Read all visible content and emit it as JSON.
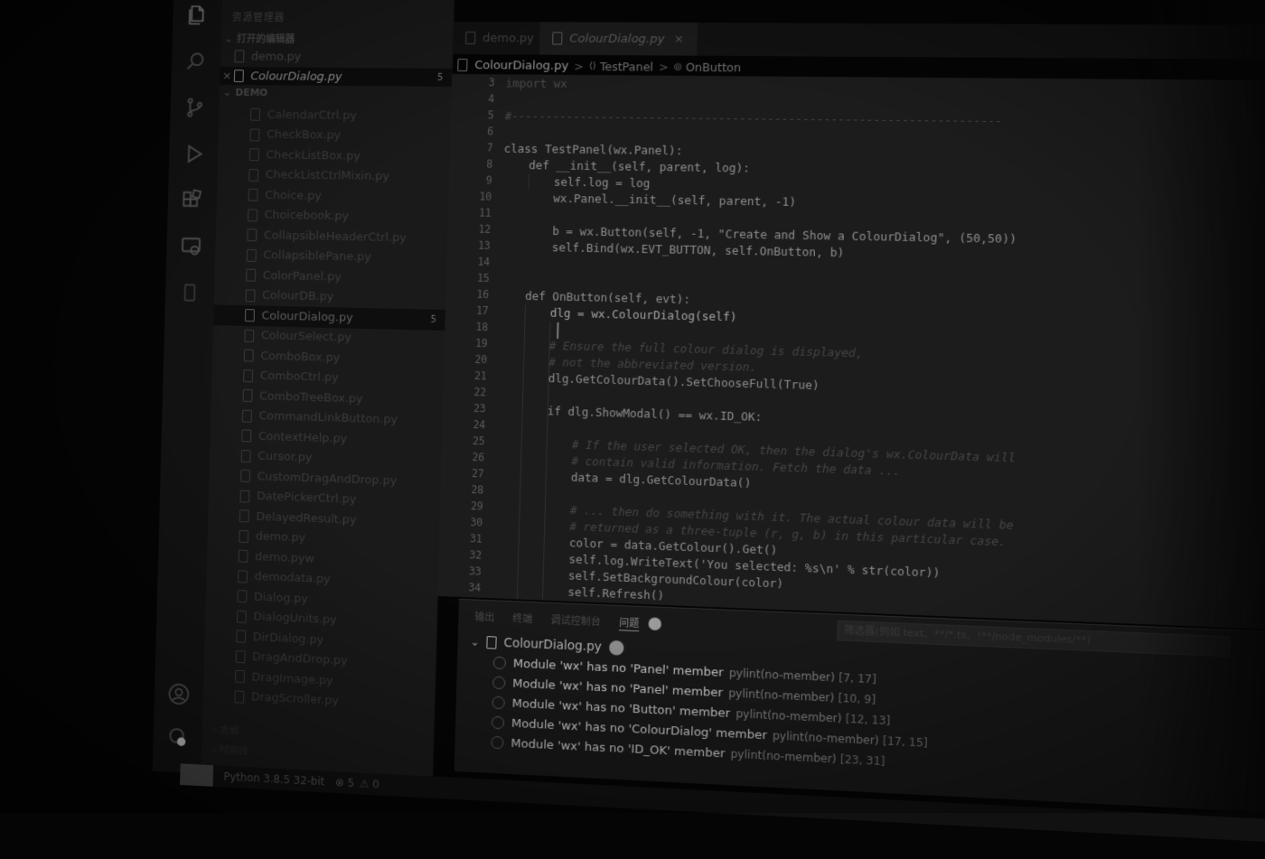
{
  "activity_bar": {
    "icons": [
      "files-icon",
      "search-icon",
      "source-control-icon",
      "run-debug-icon",
      "extensions-icon",
      "remote-icon",
      "test-icon",
      "account-icon",
      "settings-icon"
    ]
  },
  "sidebar": {
    "title": "资源管理器",
    "open_editors_header": "打开的编辑器",
    "open_editors": [
      {
        "name": "demo.py",
        "close": ""
      },
      {
        "name": "ColourDialog.py",
        "close": "×",
        "badge": "5"
      }
    ],
    "folder_header": "DEMO",
    "files": [
      {
        "name": "CalendarCtrl.py"
      },
      {
        "name": "CheckBox.py"
      },
      {
        "name": "CheckListBox.py"
      },
      {
        "name": "CheckListCtrlMixin.py"
      },
      {
        "name": "Choice.py"
      },
      {
        "name": "Choicebook.py"
      },
      {
        "name": "CollapsibleHeaderCtrl.py"
      },
      {
        "name": "CollapsiblePane.py"
      },
      {
        "name": "ColorPanel.py"
      },
      {
        "name": "ColourDB.py"
      },
      {
        "name": "ColourDialog.py",
        "active": true,
        "badge": "5"
      },
      {
        "name": "ColourSelect.py"
      },
      {
        "name": "ComboBox.py"
      },
      {
        "name": "ComboCtrl.py"
      },
      {
        "name": "ComboTreeBox.py"
      },
      {
        "name": "CommandLinkButton.py"
      },
      {
        "name": "ContextHelp.py"
      },
      {
        "name": "Cursor.py"
      },
      {
        "name": "CustomDragAndDrop.py"
      },
      {
        "name": "DatePickerCtrl.py"
      },
      {
        "name": "DelayedResult.py"
      },
      {
        "name": "demo.py"
      },
      {
        "name": "demo.pyw"
      },
      {
        "name": "demodata.py"
      },
      {
        "name": "Dialog.py"
      },
      {
        "name": "DialogUnits.py"
      },
      {
        "name": "DirDialog.py"
      },
      {
        "name": "DragAndDrop.py"
      },
      {
        "name": "DragImage.py"
      },
      {
        "name": "DragScroller.py"
      }
    ],
    "outline_header": "大纲",
    "timeline_header": "时间线"
  },
  "tabs": [
    {
      "label": "demo.py",
      "active": false,
      "close": ""
    },
    {
      "label": "ColourDialog.py",
      "active": true,
      "close": "×"
    }
  ],
  "breadcrumb": {
    "file": "ColourDialog.py",
    "class": "TestPanel",
    "method": "OnButton",
    "sep": ">"
  },
  "editor": {
    "lines": [
      {
        "n": "3",
        "text": "import wx",
        "indent": 0,
        "style": "dim"
      },
      {
        "n": "4",
        "text": "",
        "indent": 0
      },
      {
        "n": "5",
        "text": "#----------------------------------------------------------------------",
        "indent": 0,
        "style": "comment"
      },
      {
        "n": "6",
        "text": "",
        "indent": 0
      },
      {
        "n": "7",
        "text": "class TestPanel(wx.Panel):",
        "indent": 0
      },
      {
        "n": "8",
        "text": "def __init__(self, parent, log):",
        "indent": 1
      },
      {
        "n": "9",
        "text": "self.log = log",
        "indent": 2
      },
      {
        "n": "10",
        "text": "wx.Panel.__init__(self, parent, -1)",
        "indent": 2
      },
      {
        "n": "11",
        "text": "",
        "indent": 0
      },
      {
        "n": "12",
        "text": "b = wx.Button(self, -1, \"Create and Show a ColourDialog\", (50,50))",
        "indent": 2
      },
      {
        "n": "13",
        "text": "self.Bind(wx.EVT_BUTTON, self.OnButton, b)",
        "indent": 2
      },
      {
        "n": "14",
        "text": "",
        "indent": 0
      },
      {
        "n": "15",
        "text": "",
        "indent": 0
      },
      {
        "n": "16",
        "text": "def OnButton(self, evt):",
        "indent": 1
      },
      {
        "n": "17",
        "text": "dlg = wx.ColourDialog(self)",
        "indent": 2,
        "style": "bright"
      },
      {
        "n": "18",
        "text": "",
        "indent": 0
      },
      {
        "n": "19",
        "text": "# Ensure the full colour dialog is displayed,",
        "indent": 2,
        "style": "comment"
      },
      {
        "n": "20",
        "text": "# not the abbreviated version.",
        "indent": 2,
        "style": "comment"
      },
      {
        "n": "21",
        "text": "dlg.GetColourData().SetChooseFull(True)",
        "indent": 2
      },
      {
        "n": "22",
        "text": "",
        "indent": 0
      },
      {
        "n": "23",
        "text": "if dlg.ShowModal() == wx.ID_OK:",
        "indent": 2
      },
      {
        "n": "24",
        "text": "",
        "indent": 0
      },
      {
        "n": "25",
        "text": "# If the user selected OK, then the dialog's wx.ColourData will",
        "indent": 3,
        "style": "comment"
      },
      {
        "n": "26",
        "text": "# contain valid information. Fetch the data ...",
        "indent": 3,
        "style": "comment"
      },
      {
        "n": "27",
        "text": "data = dlg.GetColourData()",
        "indent": 3
      },
      {
        "n": "28",
        "text": "",
        "indent": 0
      },
      {
        "n": "29",
        "text": "# ... then do something with it. The actual colour data will be",
        "indent": 3,
        "style": "comment"
      },
      {
        "n": "30",
        "text": "# returned as a three-tuple (r, g, b) in this particular case.",
        "indent": 3,
        "style": "comment"
      },
      {
        "n": "31",
        "text": "color = data.GetColour().Get()",
        "indent": 3
      },
      {
        "n": "32",
        "text": "self.log.WriteText('You selected: %s\\n' % str(color))",
        "indent": 3
      },
      {
        "n": "33",
        "text": "self.SetBackgroundColour(color)",
        "indent": 3
      },
      {
        "n": "34",
        "text": "self.Refresh()",
        "indent": 3
      }
    ]
  },
  "panel": {
    "tabs": [
      "输出",
      "终端",
      "调试控制台",
      "问题"
    ],
    "active_tab": "问题",
    "filter_placeholder": "筛选器(例如 text、**/*.ts、!**/node_modules/**)",
    "file": "ColourDialog.py",
    "file_count": "5",
    "problems": [
      {
        "message": "Module 'wx' has no 'Panel' member",
        "source": "pylint(no-member)",
        "location": "[7, 17]"
      },
      {
        "message": "Module 'wx' has no 'Panel' member",
        "source": "pylint(no-member)",
        "location": "[10, 9]"
      },
      {
        "message": "Module 'wx' has no 'Button' member",
        "source": "pylint(no-member)",
        "location": "[12, 13]"
      },
      {
        "message": "Module 'wx' has no 'ColourDialog' member",
        "source": "pylint(no-member)",
        "location": "[17, 15]"
      },
      {
        "message": "Module 'wx' has no 'ID_OK' member",
        "source": "pylint(no-member)",
        "location": "[23, 31]"
      }
    ]
  },
  "status_bar": {
    "interpreter": "Python 3.8.5 32-bit",
    "errors": "⊗ 5",
    "warnings": "⚠ 0"
  }
}
